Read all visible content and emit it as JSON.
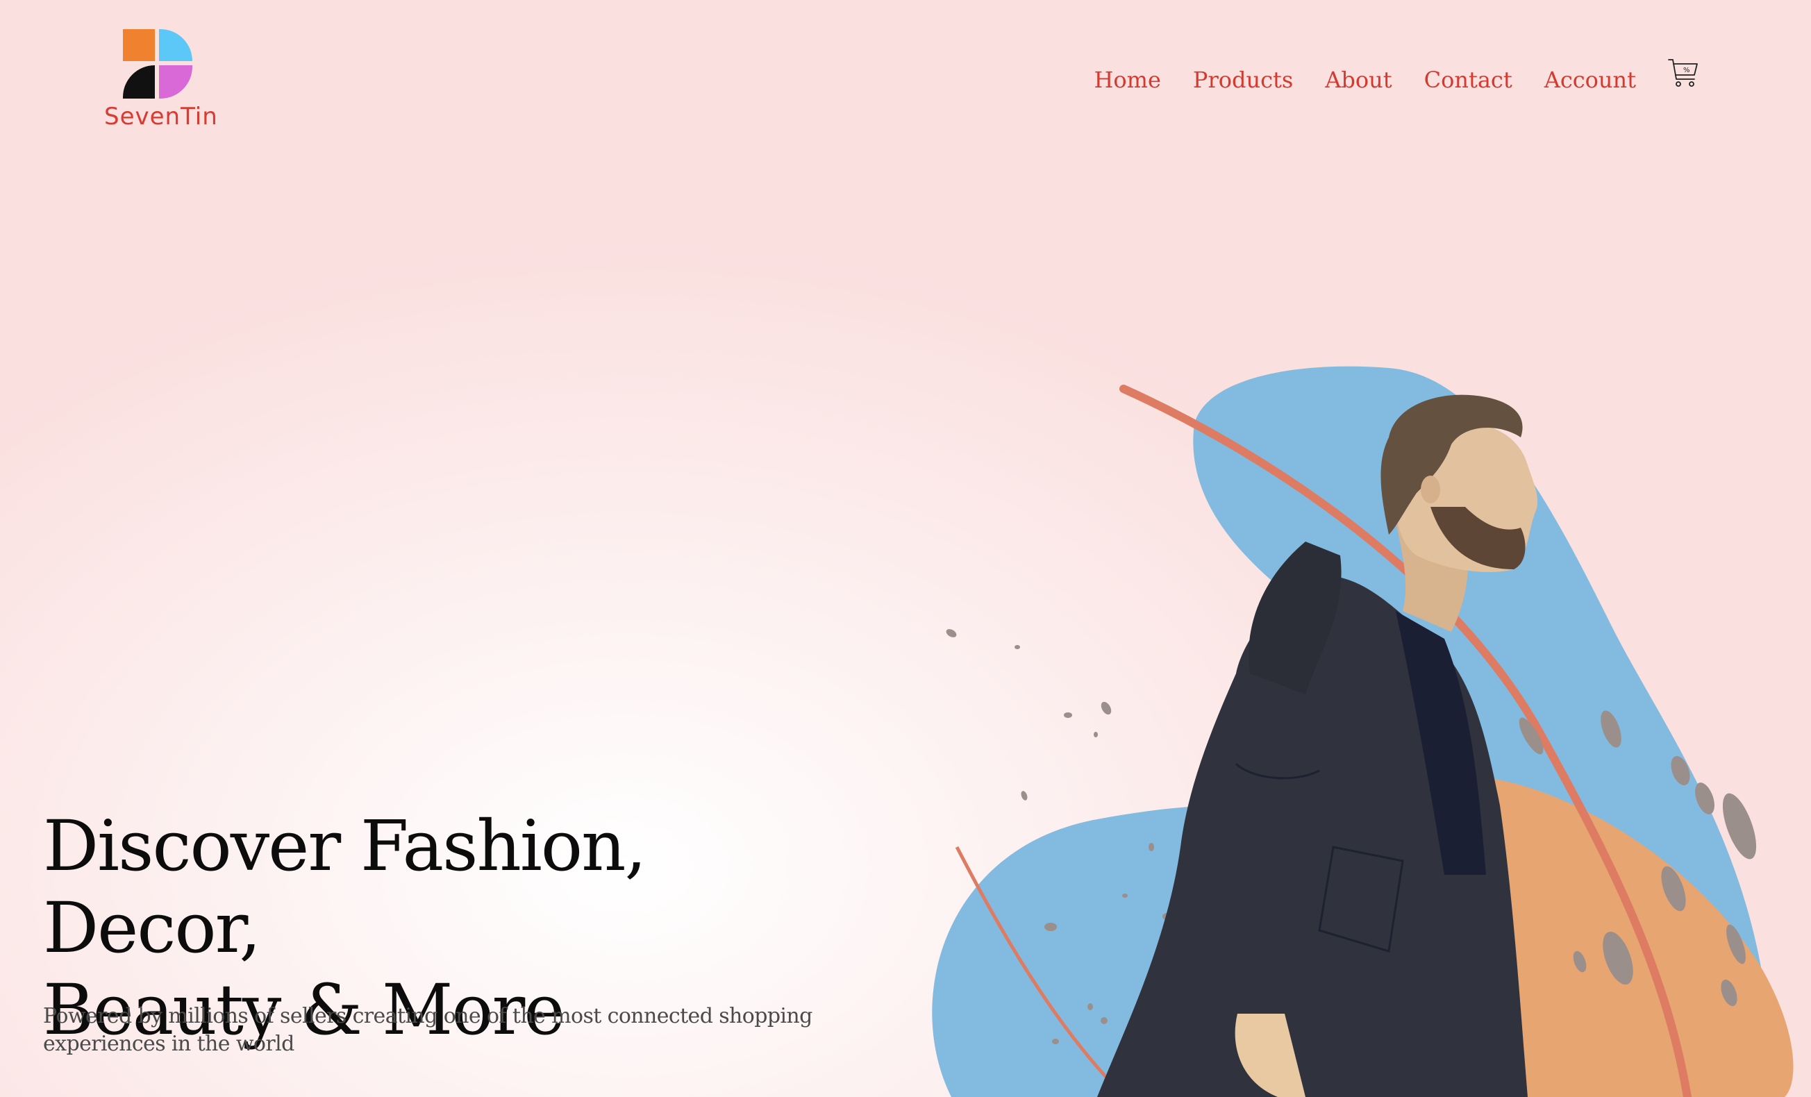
{
  "brand": {
    "name": "SevenTin",
    "logo_colors": [
      "#f0812f",
      "#5cc8f7",
      "#111111",
      "#d869d6"
    ]
  },
  "nav": {
    "items": [
      {
        "label": "Home"
      },
      {
        "label": "Products"
      },
      {
        "label": "About"
      },
      {
        "label": "Contact"
      },
      {
        "label": "Account"
      }
    ],
    "cart_icon": "shopping-cart-icon",
    "link_color": "#d43a2f"
  },
  "hero": {
    "title_line1": "Discover Fashion, Decor,",
    "title_line2": "Beauty & More",
    "subtitle": "Powered by millions of sellers creating one of the most connected shopping experiences in the world",
    "illustration": "man-in-coat-illustration"
  },
  "colors": {
    "background": "#fbe3e2",
    "blob_blue": "#83bbe0",
    "blob_orange": "#e7a571",
    "accent_line": "#de7c63",
    "coat": "#30333d"
  }
}
